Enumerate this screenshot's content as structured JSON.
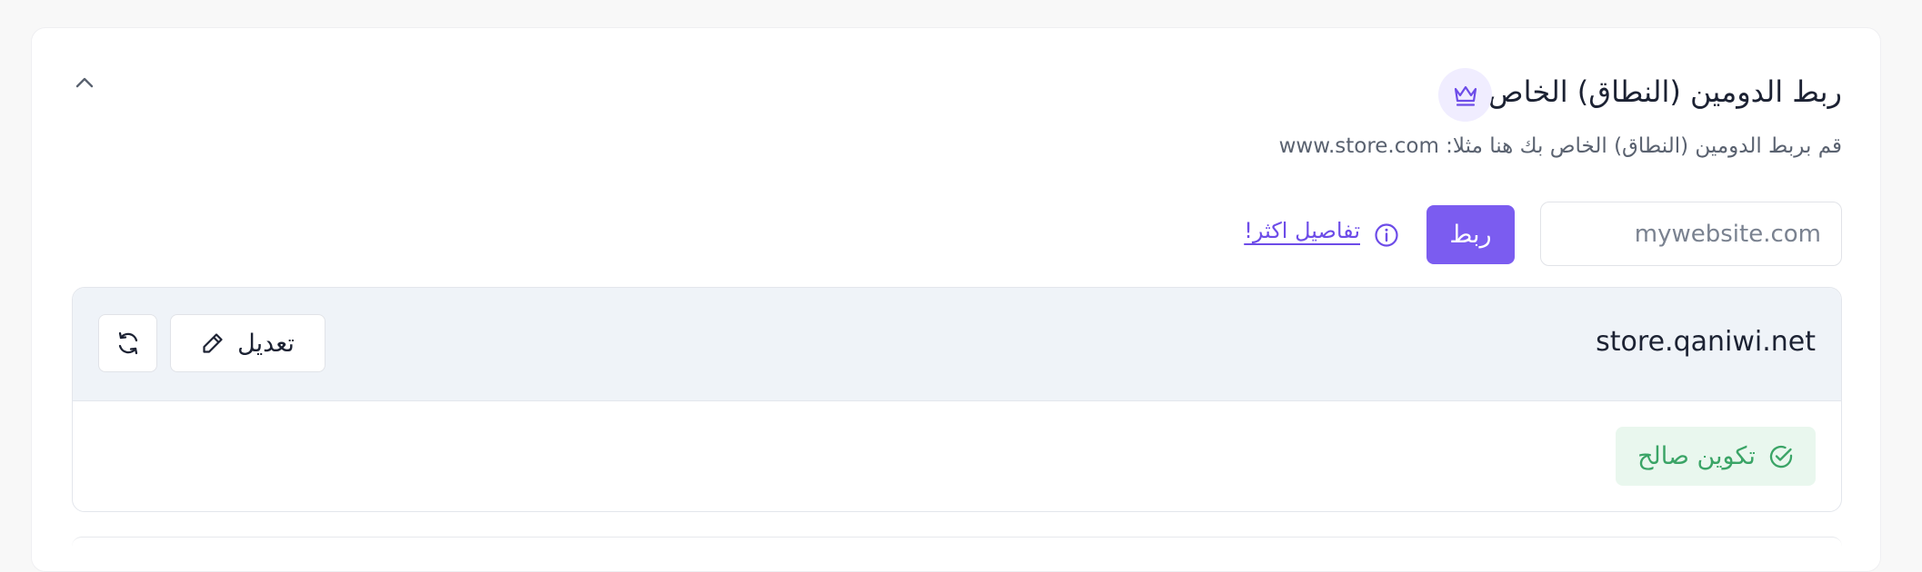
{
  "header": {
    "title": "ربط الدومين (النطاق) الخاص",
    "subtitle": "قم بربط الدومين (النطاق) الخاص بك هنا مثلا: www.store.com",
    "crown_icon": "crown-icon",
    "collapse_icon": "chevron-up-icon"
  },
  "connect": {
    "input_placeholder": "mywebsite.com",
    "input_value": "",
    "button_label": "ربط",
    "more_link": "تفاصيل اكثر!",
    "info_icon": "info-icon"
  },
  "domain": {
    "name": "store.qaniwi.net",
    "edit_label": "تعديل",
    "edit_icon": "pencil-icon",
    "refresh_icon": "refresh-icon",
    "status_label": "تكوين صالح",
    "status_icon": "check-circle-icon"
  },
  "colors": {
    "accent": "#7b5cf0",
    "accent_soft": "#f0edff",
    "success": "#3aa466",
    "success_bg": "#e9f7ee",
    "panel_head_bg": "#eff3f8"
  }
}
